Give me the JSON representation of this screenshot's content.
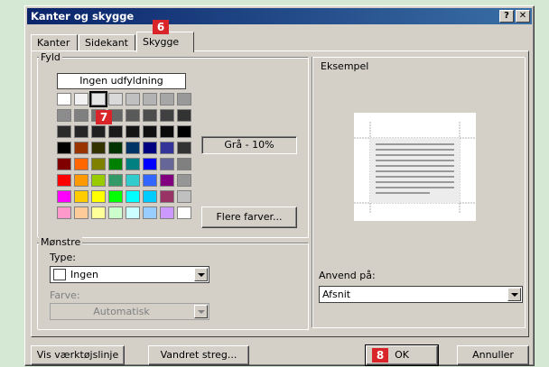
{
  "window": {
    "title": "Kanter og skygge",
    "help_btn": "?",
    "close_btn": "✕"
  },
  "tabs": [
    {
      "label": "Kanter"
    },
    {
      "label": "Sidekant"
    },
    {
      "label": "Skygge",
      "active": true
    }
  ],
  "fill": {
    "group_label": "Fyld",
    "no_fill_label": "Ingen udfyldning",
    "selected_color_name": "Grå - 10%",
    "more_colors_button": "Flere farver...",
    "palette_rows": [
      [
        "#ffffff",
        "#f2f2f2",
        "#e6e6e6",
        "#d9d9d9",
        "#c0c0c0",
        "#b3b3b3",
        "#a6a6a6",
        "#999999"
      ],
      [
        "#8c8c8c",
        "#808080",
        "#737373",
        "#666666",
        "#595959",
        "#4d4d4d",
        "#404040",
        "#333333"
      ],
      [
        "#2b2b2b",
        "#262626",
        "#202020",
        "#1a1a1a",
        "#141414",
        "#101010",
        "#0a0a0a",
        "#000000"
      ],
      [
        "#000000",
        "#993300",
        "#333300",
        "#003300",
        "#003366",
        "#000080",
        "#333399",
        "#333333"
      ],
      [
        "#800000",
        "#ff6600",
        "#808000",
        "#008000",
        "#008080",
        "#0000ff",
        "#666699",
        "#808080"
      ],
      [
        "#ff0000",
        "#ff9900",
        "#99cc00",
        "#339966",
        "#33cccc",
        "#3366ff",
        "#800080",
        "#969696"
      ],
      [
        "#ff00ff",
        "#ffcc00",
        "#ffff00",
        "#00ff00",
        "#00ffff",
        "#00ccff",
        "#993366",
        "#c0c0c0"
      ],
      [
        "#ff99cc",
        "#ffcc99",
        "#ffff99",
        "#ccffcc",
        "#ccffff",
        "#99ccff",
        "#cc99ff",
        "#ffffff"
      ]
    ]
  },
  "pattern": {
    "group_label": "Mønstre",
    "type_label": "Type:",
    "type_value": "Ingen",
    "color_label": "Farve:",
    "color_value": "Automatisk"
  },
  "preview": {
    "group_label": "Eksempel"
  },
  "apply": {
    "label": "Anvend på:",
    "value": "Afsnit"
  },
  "buttons": {
    "toolbar": "Vis værktøjslinje",
    "horizontal_line": "Vandret streg...",
    "ok": "OK",
    "cancel": "Annuller"
  },
  "badges": {
    "tab": "6",
    "palette": "7",
    "ok": "8"
  },
  "colors": {
    "accent_badge": "#d9252a",
    "titlebar": "#0a246a"
  }
}
